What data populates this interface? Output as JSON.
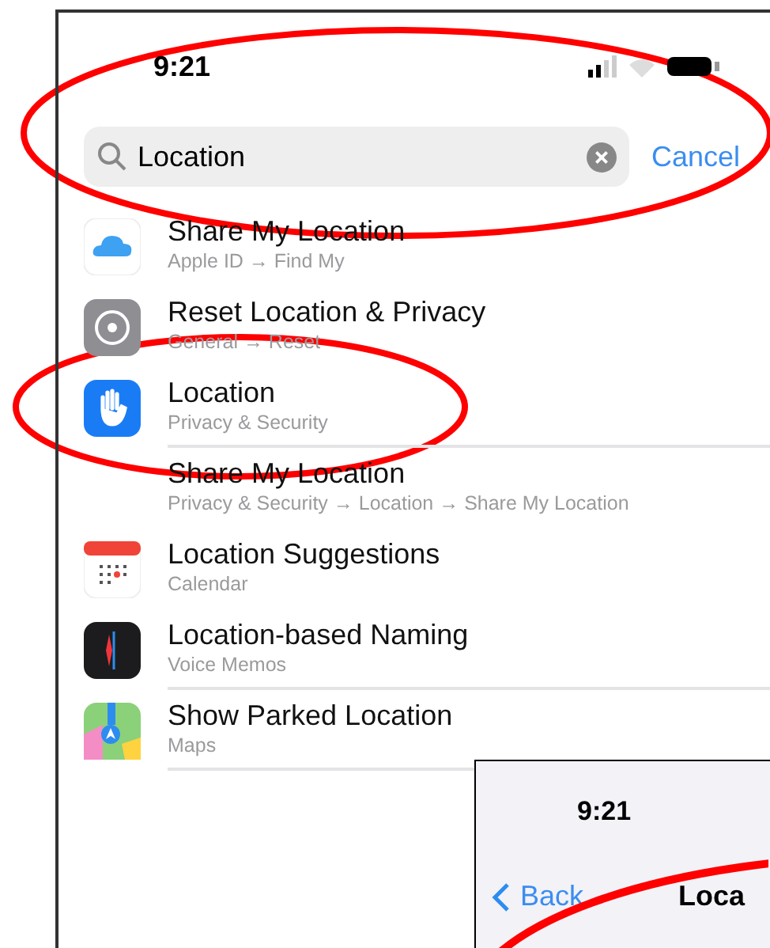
{
  "status_bar": {
    "time": "9:21"
  },
  "search": {
    "value": "Location",
    "cancel": "Cancel",
    "circled": true
  },
  "results": [
    {
      "kind": "cloud",
      "title": "Share My Location",
      "subtitle": "Apple ID → Find My",
      "separator": false,
      "circled": false
    },
    {
      "kind": "gear",
      "title": "Reset Location & Privacy",
      "subtitle": "General → Reset",
      "separator": false,
      "circled": false
    },
    {
      "kind": "hand",
      "title": "Location",
      "subtitle": "Privacy & Security",
      "separator": true,
      "circled": true
    },
    {
      "kind": "plain",
      "title": "Share My Location",
      "subtitle": "Privacy & Security → Location → Share My Location",
      "separator": false,
      "circled": false
    },
    {
      "kind": "calendar",
      "title": "Location Suggestions",
      "subtitle": "Calendar",
      "separator": false,
      "circled": false
    },
    {
      "kind": "voice",
      "title": "Location-based Naming",
      "subtitle": "Voice Memos",
      "separator": true,
      "circled": false
    },
    {
      "kind": "maps",
      "title": "Show Parked Location",
      "subtitle": "Maps",
      "separator": true,
      "circled": false
    }
  ],
  "inset": {
    "time": "9:21",
    "back": "Back",
    "title": "Loca",
    "circled": true
  }
}
